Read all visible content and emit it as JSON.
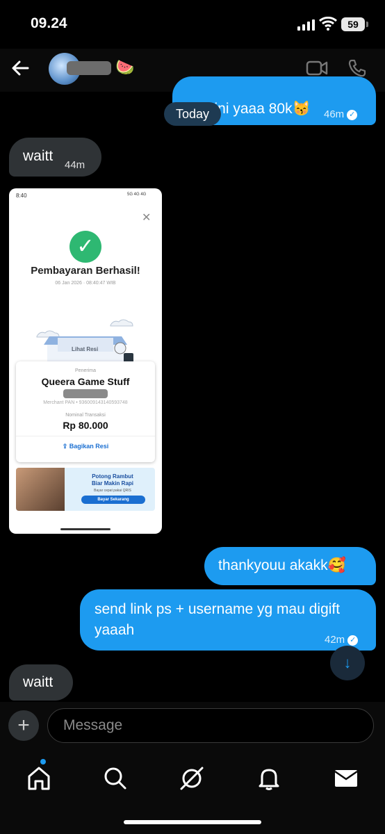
{
  "status": {
    "time": "09.24",
    "battery": "59"
  },
  "header": {
    "contact_emoji": "🍉"
  },
  "date_divider": "Today",
  "messages": [
    {
      "side": "out",
      "text": "kak ini yaaa 80k😽",
      "time": "46m"
    },
    {
      "side": "in",
      "text": "waitt",
      "time": "44m"
    },
    {
      "side": "out",
      "text": "thankyouu akakk🥰"
    },
    {
      "side": "out",
      "text": "send link ps + username yg mau digift yaaah",
      "time": "42m"
    },
    {
      "side": "in",
      "text": "waitt"
    }
  ],
  "receipt": {
    "status_time": "8:40",
    "status_right": "5G 4G 4G",
    "title": "Pembayaran Berhasil!",
    "date": "06 Jan 2026 · 08:40:47 WIB",
    "illustration_label": "Lihat Resi",
    "recipient_label": "Penerima",
    "merchant": "Queera Game Stuff",
    "pan": "Merchant PAN • 936009143140593748",
    "amount_label": "Nominal Transaksi",
    "amount": "Rp 80.000",
    "share_label": "Bagikan Resi",
    "banner_title": "Potong Rambut\nBiar Makin Rapi",
    "banner_sub": "Bayar cepat pakai QRIS",
    "banner_button": "Bayar Sekarang"
  },
  "composer": {
    "placeholder": "Message"
  },
  "tabs": [
    "home",
    "search",
    "grok",
    "notifications",
    "messages"
  ],
  "colors": {
    "accent": "#1d9bf0",
    "incoming": "#2f3336",
    "background": "#000000"
  }
}
